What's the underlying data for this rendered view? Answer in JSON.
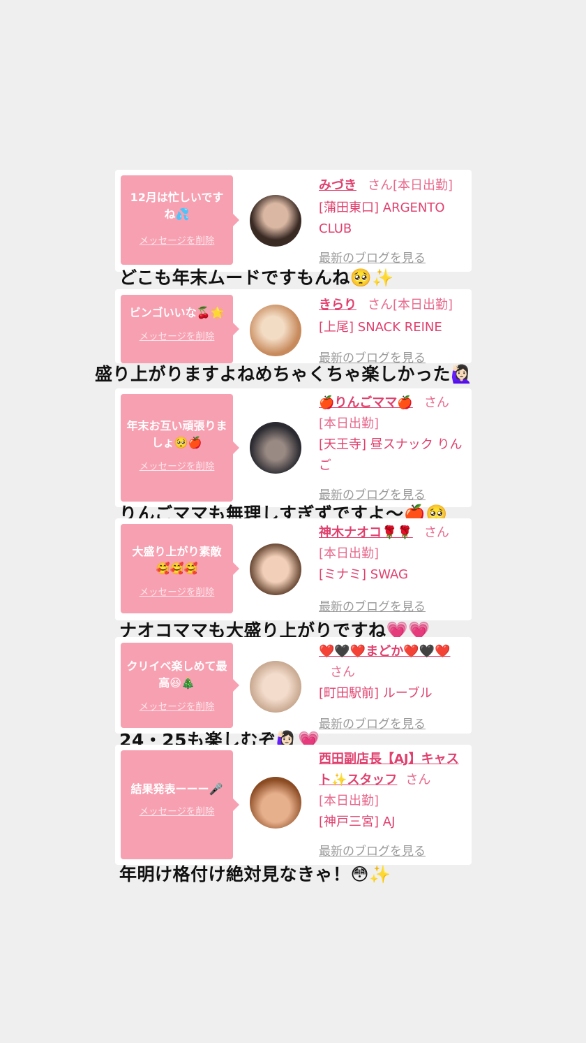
{
  "cards": [
    {
      "message": "12月は忙しいですね💦",
      "delete_label": "メッセージを削除",
      "name": "みづき",
      "san": "さん",
      "work": "[本日出勤]",
      "shop": "[蒲田東口] ARGENTO CLUB",
      "blog_label": "最新のブログを見る",
      "caption": "どこも年末ムードですもんね🥺✨",
      "avatar_colors": [
        "#3a2a24",
        "#d9b7a2"
      ]
    },
    {
      "message": "ビンゴいいな🍒🌟",
      "delete_label": "メッセージを削除",
      "name": "きらり",
      "san": "さん",
      "work": "[本日出勤]",
      "shop": "[上尾] SNACK REINE",
      "blog_label": "最新のブログを見る",
      "caption": "盛り上がりますよねめちゃくちゃ楽しかった🙋🏻‍♀️",
      "avatar_colors": [
        "#e8c9a8",
        "#c78a5c"
      ]
    },
    {
      "message": "年末お互い頑張りましょ🥺🍎",
      "delete_label": "メッセージを削除",
      "name": "🍎りんごママ🍎",
      "san": "さん",
      "work": "[本日出勤]",
      "shop": "[天王寺] 昼スナック りんご",
      "blog_label": "最新のブログを見る",
      "caption": "りんごママも無理しすぎずですよ〜🍎🥺",
      "avatar_colors": [
        "#2a2a30",
        "#9a8a84"
      ]
    },
    {
      "message": "大盛り上がり素敵🥰🥰🥰",
      "delete_label": "メッセージを削除",
      "name": "神木ナオコ🌹🌹",
      "san": "さん",
      "work": "[本日出勤]",
      "shop": "[ミナミ] SWAG",
      "blog_label": "最新のブログを見る",
      "caption": "ナオコママも大盛り上がりですね💗💗",
      "avatar_colors": [
        "#6b4a36",
        "#f1cfb8"
      ]
    },
    {
      "message": "クリイベ楽しめて最高😆🎄",
      "delete_label": "メッセージを削除",
      "name": "❤️🖤❤️まどか❤️🖤❤️",
      "san": "さん",
      "work": "",
      "shop": "[町田駅前] ルーブル",
      "blog_label": "最新のブログを見る",
      "caption": "24・25も楽しむぞ🙋🏻‍♀️💗",
      "avatar_colors": [
        "#c8a890",
        "#f3dccc"
      ]
    },
    {
      "message": "結果発表ーーー🎤",
      "delete_label": "メッセージを削除",
      "name": "西田副店長【AJ】キャスト✨スタッフ",
      "san": "さん",
      "work": "[本日出勤]",
      "shop": "[神戸三宮] AJ",
      "blog_label": "最新のブログを見る",
      "caption": "年明け格付け絶対見なきゃ！😳✨",
      "avatar_colors": [
        "#8a4a22",
        "#e7b08c"
      ]
    }
  ],
  "colors": {
    "bubble": "#f7a0b1",
    "name": "#e0406e",
    "page_bg": "#efefef"
  }
}
